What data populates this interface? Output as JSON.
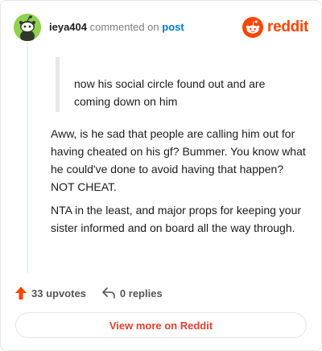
{
  "header": {
    "username": "ieya404",
    "action_text": "commented on",
    "post_link": "post",
    "brand": "reddit"
  },
  "comment": {
    "quote": "now his social circle found out and are coming down on him",
    "paragraphs": [
      "Aww, is he sad that people are calling him out for having cheated on his gf? Bummer. You know what he could've done to avoid having that happen? NOT CHEAT.",
      "NTA in the least, and major props for keeping your sister informed and on board all the way through."
    ]
  },
  "actions": {
    "upvotes": "33 upvotes",
    "replies": "0 replies"
  },
  "footer": {
    "view_more": "View more on Reddit"
  },
  "colors": {
    "brand": "#ff4500",
    "link": "#0079d3",
    "avatar": "#8fd14f"
  },
  "icons": [
    "snoo-avatar-icon",
    "reddit-logo-icon",
    "upvote-arrow-icon",
    "reply-arrow-icon"
  ]
}
